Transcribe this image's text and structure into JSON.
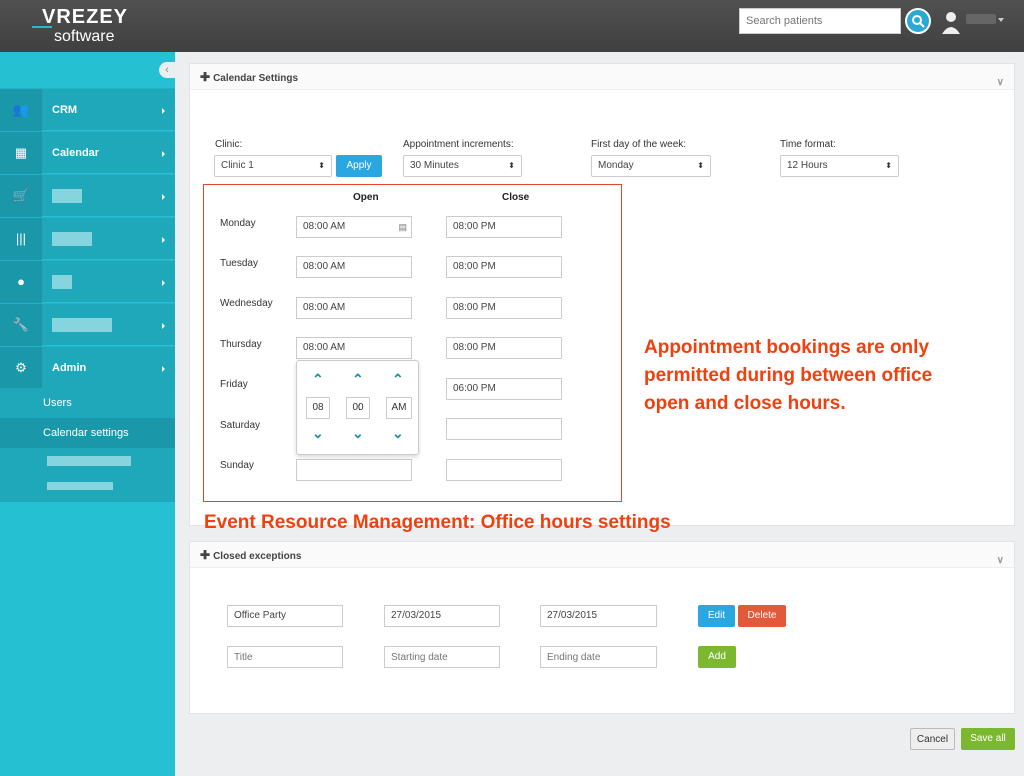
{
  "header": {
    "logo_top": "VREZEY",
    "logo_bottom": "software",
    "search_placeholder": "Search patients"
  },
  "sidebar": {
    "items": [
      {
        "label": "CRM",
        "icon": "users-icon"
      },
      {
        "label": "Calendar",
        "icon": "calendar-icon"
      },
      {
        "label": "",
        "icon": "cart-icon"
      },
      {
        "label": "",
        "icon": "barcode-icon"
      },
      {
        "label": "",
        "icon": "user-icon"
      },
      {
        "label": "",
        "icon": "wrench-icon"
      },
      {
        "label": "Admin",
        "icon": "gears-icon"
      }
    ],
    "sub": [
      "Users",
      "Calendar settings"
    ]
  },
  "calendar": {
    "title": "Calendar Settings",
    "clinic_label": "Clinic:",
    "clinic_value": "Clinic 1",
    "apply": "Apply",
    "increments_label": "Appointment increments:",
    "increments_value": "30 Minutes",
    "firstday_label": "First day of the week:",
    "firstday_value": "Monday",
    "timeformat_label": "Time format:",
    "timeformat_value": "12 Hours",
    "open_header": "Open",
    "close_header": "Close",
    "days": [
      {
        "day": "Monday",
        "open": "08:00 AM",
        "close": "08:00 PM"
      },
      {
        "day": "Tuesday",
        "open": "08:00 AM",
        "close": "08:00 PM"
      },
      {
        "day": "Wednesday",
        "open": "08:00 AM",
        "close": "08:00 PM"
      },
      {
        "day": "Thursday",
        "open": "08:00 AM",
        "close": "08:00 PM"
      },
      {
        "day": "Friday",
        "open": "",
        "close": "06:00 PM"
      },
      {
        "day": "Saturday",
        "open": "",
        "close": ""
      },
      {
        "day": "Sunday",
        "open": "",
        "close": ""
      }
    ],
    "picker": {
      "hour": "08",
      "minute": "00",
      "meridian": "AM"
    }
  },
  "annotation_main": "Appointment bookings are only permitted during between office open and close hours.",
  "annotation_title": "Event Resource Management: Office hours settings",
  "exceptions": {
    "title": "Closed exceptions",
    "row": {
      "title": "Office Party",
      "start": "27/03/2015",
      "end": "27/03/2015",
      "edit": "Edit",
      "delete": "Delete"
    },
    "new": {
      "title_ph": "Title",
      "start_ph": "Starting date",
      "end_ph": "Ending date",
      "add": "Add"
    }
  },
  "footer": {
    "cancel": "Cancel",
    "save": "Save all"
  },
  "colors": {
    "accent": "#25c1d2",
    "apply": "#2aa7e1",
    "delete": "#e25a3a",
    "add": "#7cb82f",
    "annotation": "#f0400e"
  }
}
